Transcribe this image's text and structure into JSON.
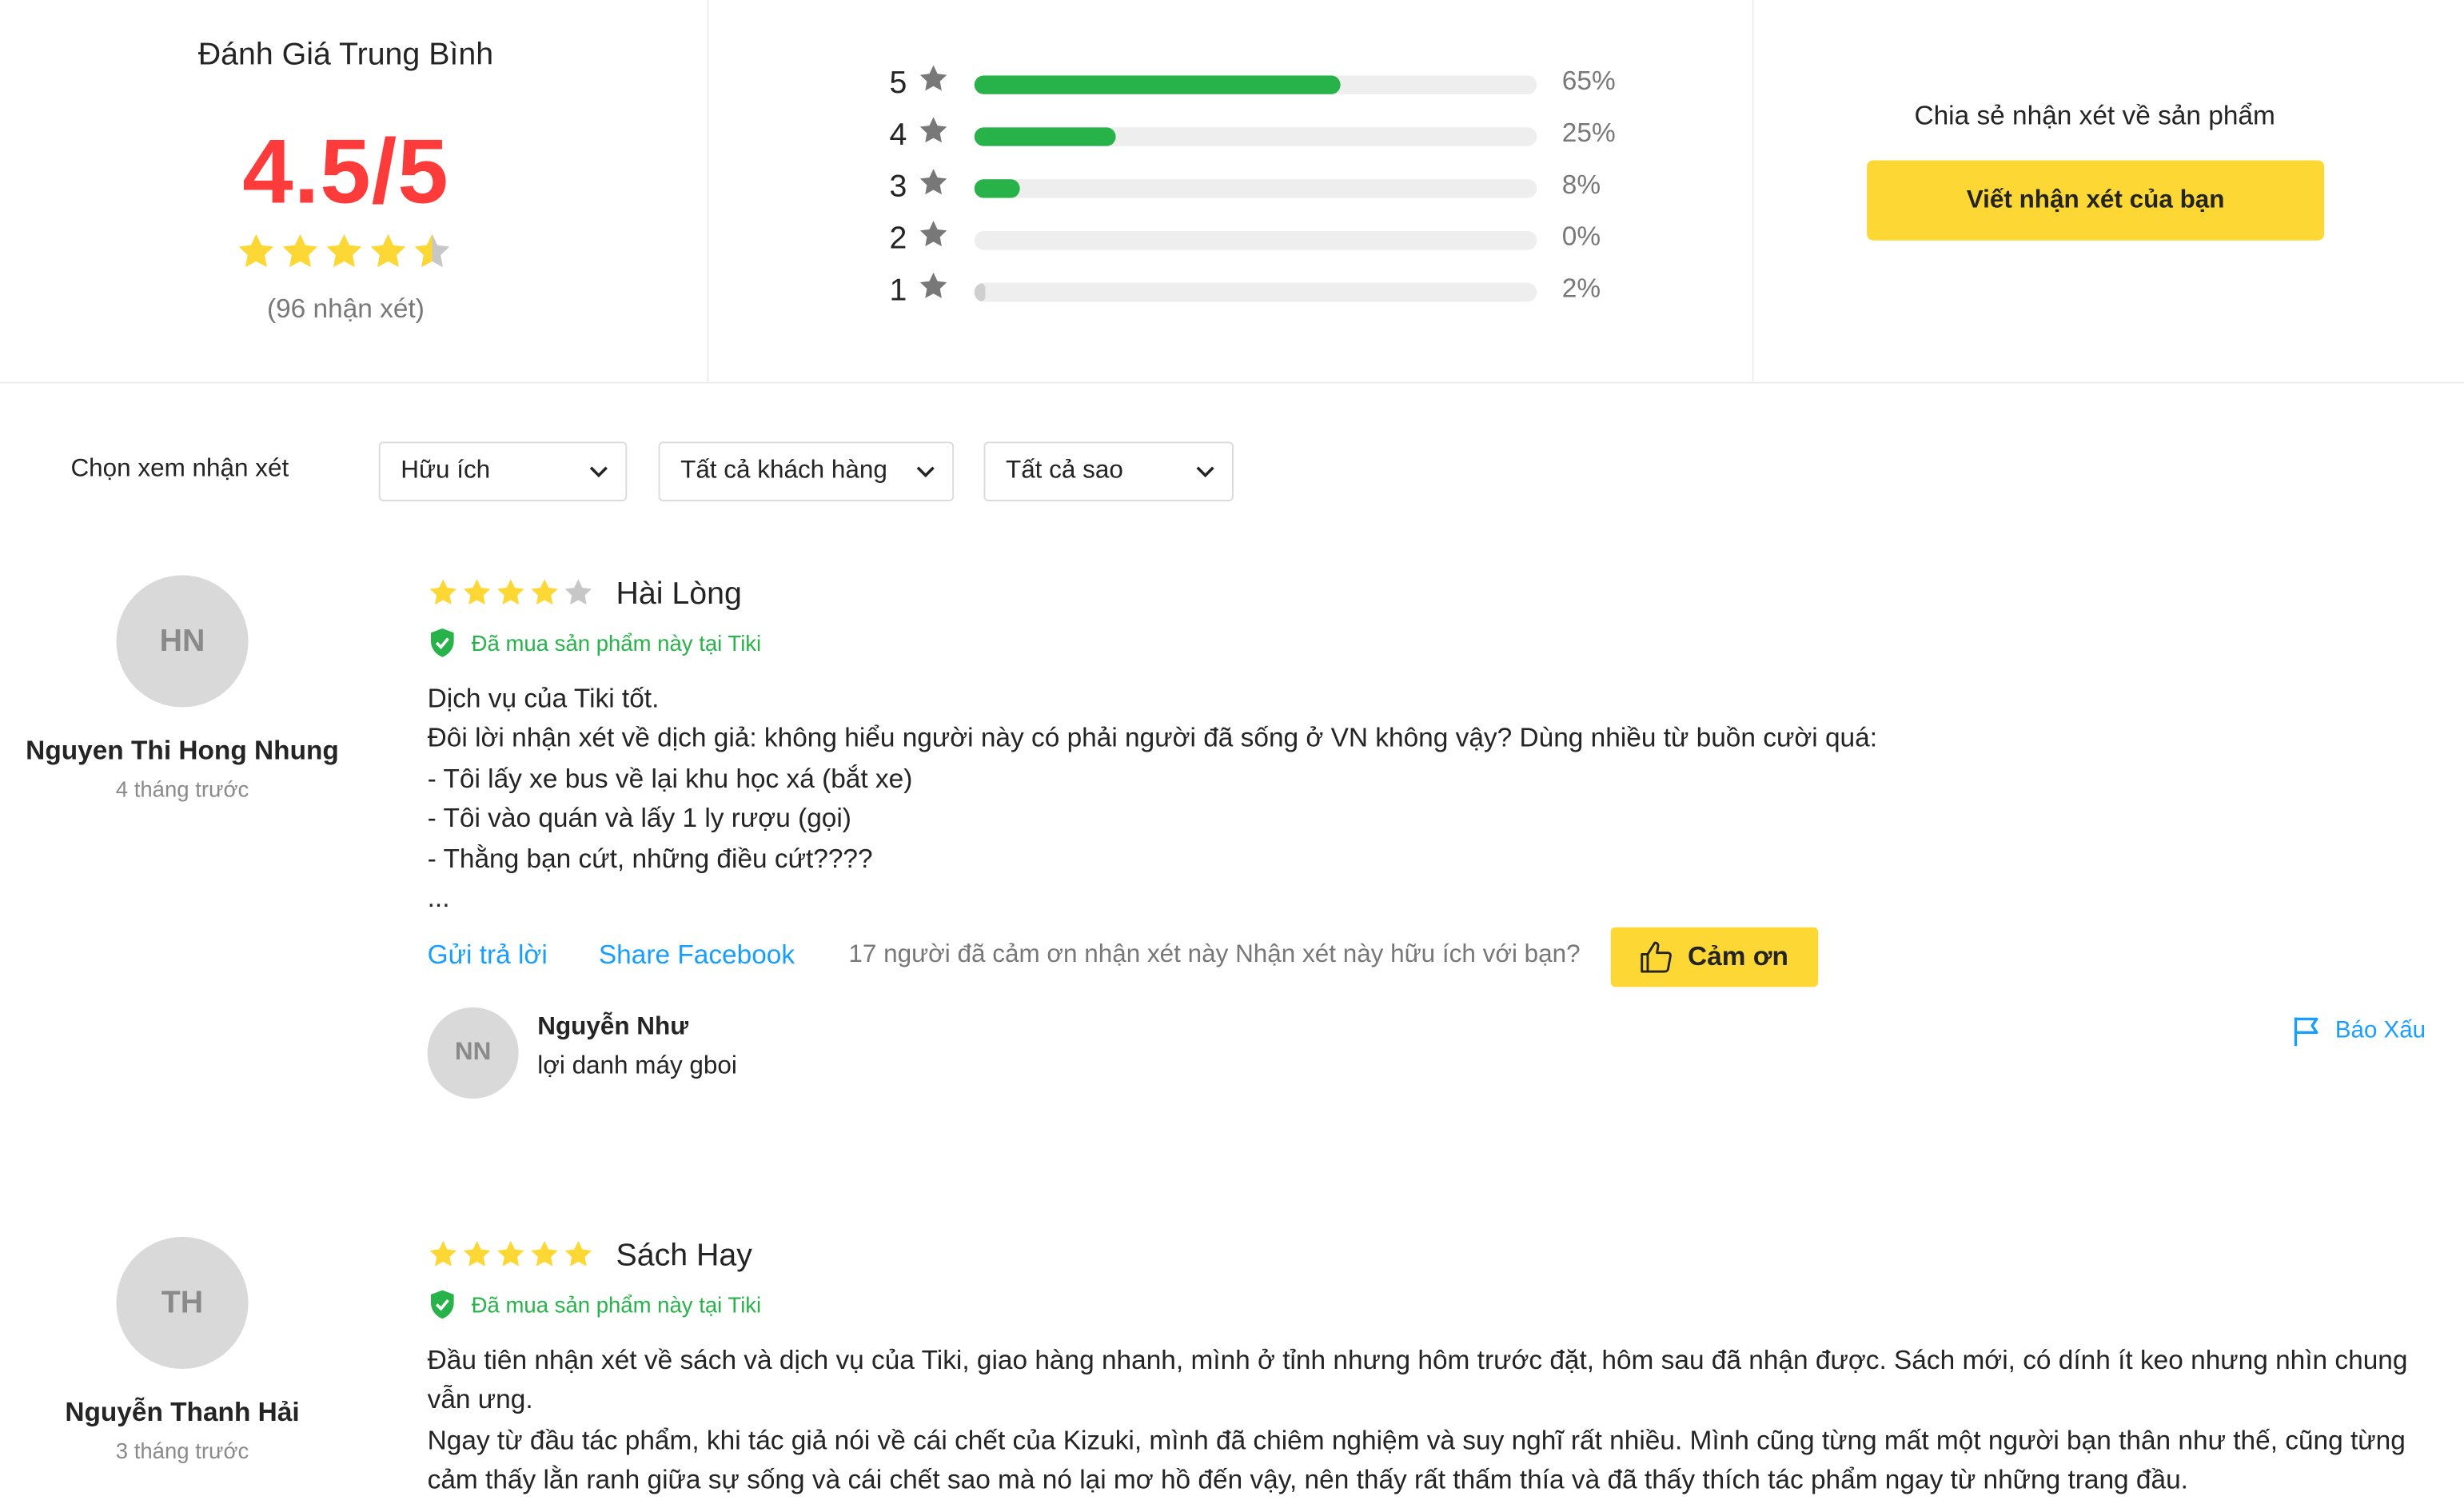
{
  "colors": {
    "accent_yellow": "#fdd835",
    "star": "#fdd835",
    "rating_red": "#fd3b3b",
    "bar_green": "#27b34a",
    "link_blue": "#189eff",
    "verified_green": "#27b34a"
  },
  "summary": {
    "title": "Đánh Giá Trung Bình",
    "average": "4.5/5",
    "average_value": 4.5,
    "count_label": "(96 nhận xét)",
    "breakdown": [
      {
        "stars": "5",
        "percent": 65,
        "label": "65%"
      },
      {
        "stars": "4",
        "percent": 25,
        "label": "25%"
      },
      {
        "stars": "3",
        "percent": 8,
        "label": "8%"
      },
      {
        "stars": "2",
        "percent": 0,
        "label": "0%"
      },
      {
        "stars": "1",
        "percent": 2,
        "label": "2%"
      }
    ],
    "share_text": "Chia sẻ nhận xét về sản phẩm",
    "write_button": "Viết nhận xét của bạn"
  },
  "filter": {
    "label": "Chọn xem nhận xét",
    "sort": "Hữu ích",
    "customers": "Tất cả khách hàng",
    "stars": "Tất cả sao"
  },
  "reviews": [
    {
      "initials": "HN",
      "author": "Nguyen Thi Hong Nhung",
      "time_ago": "4 tháng trước",
      "rating": 4,
      "title": "Hài Lòng",
      "verified": "Đã mua sản phẩm này tại Tiki",
      "lines": [
        "Dịch vụ của Tiki tốt.",
        "Đôi lời nhận xét về dịch giả: không hiểu người này có phải người đã sống ở VN không vậy? Dùng nhiều từ buồn cười quá:",
        "- Tôi lấy xe bus về lại khu học xá (bắt xe)",
        "- Tôi vào quán và lấy 1 ly rượu (gọi)",
        "- Thằng bạn cứt, những điều cứt????",
        "..."
      ],
      "reply_link": "Gửi trả lời",
      "share_link": "Share Facebook",
      "thanks_text": "17 người đã cảm ơn nhận xét này Nhận xét này hữu ích với bạn?",
      "thanks_button": "Cảm ơn",
      "reply": {
        "initials": "NN",
        "author": "Nguyễn Như",
        "text": "lợi danh máy gboi"
      },
      "report": "Báo Xấu"
    },
    {
      "initials": "TH",
      "author": "Nguyễn Thanh Hải",
      "time_ago": "3 tháng trước",
      "rating": 5,
      "title": "Sách Hay",
      "verified": "Đã mua sản phẩm này tại Tiki",
      "lines": [
        "Đầu tiên nhận xét về sách và dịch vụ của Tiki, giao hàng nhanh, mình ở tỉnh nhưng hôm trước đặt, hôm sau đã nhận được. Sách mới, có dính ít keo nhưng nhìn chung vẫn ưng.",
        "Ngay từ đầu tác phẩm, khi tác giả nói về cái chết của Kizuki, mình đã chiêm nghiệm và suy nghĩ rất nhiều. Mình cũng từng mất một người bạn thân như thế, cũng từng cảm thấy lằn ranh giữa sự sống và cái chết sao mà nó lại mơ hồ đến vậy, nên thấy rất thấm thía và đã thấy thích tác phẩm ngay từ những trang đầu."
      ]
    }
  ]
}
